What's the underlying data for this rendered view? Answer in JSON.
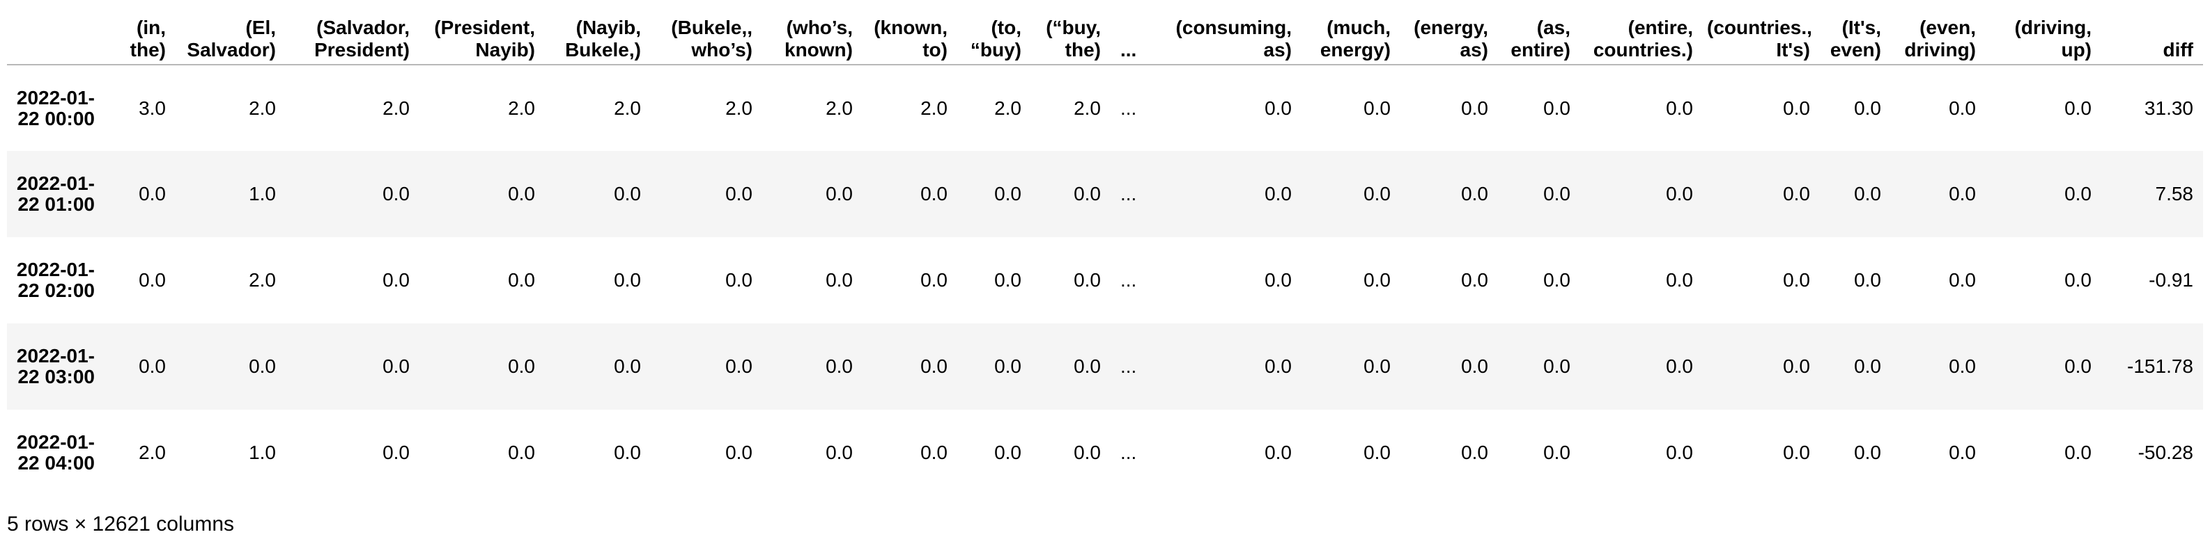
{
  "table": {
    "index_header": "",
    "columns": [
      "(in, the)",
      "(El, Salvador)",
      "(Salvador, President)",
      "(President, Nayib)",
      "(Nayib, Bukele,)",
      "(Bukele,, who’s)",
      "(who’s, known)",
      "(known, to)",
      "(to, “buy)",
      "(“buy, the)",
      "...",
      "(consuming, as)",
      "(much, energy)",
      "(energy, as)",
      "(as, entire)",
      "(entire, countries.)",
      "(countries., It's)",
      "(It's, even)",
      "(even, driving)",
      "(driving, up)",
      "diff"
    ],
    "rows": [
      {
        "index": "2022-01-22 00:00",
        "cells": [
          "3.0",
          "2.0",
          "2.0",
          "2.0",
          "2.0",
          "2.0",
          "2.0",
          "2.0",
          "2.0",
          "2.0",
          "...",
          "0.0",
          "0.0",
          "0.0",
          "0.0",
          "0.0",
          "0.0",
          "0.0",
          "0.0",
          "0.0",
          "31.30"
        ]
      },
      {
        "index": "2022-01-22 01:00",
        "cells": [
          "0.0",
          "1.0",
          "0.0",
          "0.0",
          "0.0",
          "0.0",
          "0.0",
          "0.0",
          "0.0",
          "0.0",
          "...",
          "0.0",
          "0.0",
          "0.0",
          "0.0",
          "0.0",
          "0.0",
          "0.0",
          "0.0",
          "0.0",
          "7.58"
        ]
      },
      {
        "index": "2022-01-22 02:00",
        "cells": [
          "0.0",
          "2.0",
          "0.0",
          "0.0",
          "0.0",
          "0.0",
          "0.0",
          "0.0",
          "0.0",
          "0.0",
          "...",
          "0.0",
          "0.0",
          "0.0",
          "0.0",
          "0.0",
          "0.0",
          "0.0",
          "0.0",
          "0.0",
          "-0.91"
        ]
      },
      {
        "index": "2022-01-22 03:00",
        "cells": [
          "0.0",
          "0.0",
          "0.0",
          "0.0",
          "0.0",
          "0.0",
          "0.0",
          "0.0",
          "0.0",
          "0.0",
          "...",
          "0.0",
          "0.0",
          "0.0",
          "0.0",
          "0.0",
          "0.0",
          "0.0",
          "0.0",
          "0.0",
          "-151.78"
        ]
      },
      {
        "index": "2022-01-22 04:00",
        "cells": [
          "2.0",
          "1.0",
          "0.0",
          "0.0",
          "0.0",
          "0.0",
          "0.0",
          "0.0",
          "0.0",
          "0.0",
          "...",
          "0.0",
          "0.0",
          "0.0",
          "0.0",
          "0.0",
          "0.0",
          "0.0",
          "0.0",
          "0.0",
          "-50.28"
        ]
      }
    ]
  },
  "footer": {
    "shape_text": "5 rows × 12621 columns"
  },
  "colors": {
    "stripe": "#f5f5f5",
    "header_rule": "#b8b8b8",
    "text": "#000000"
  }
}
